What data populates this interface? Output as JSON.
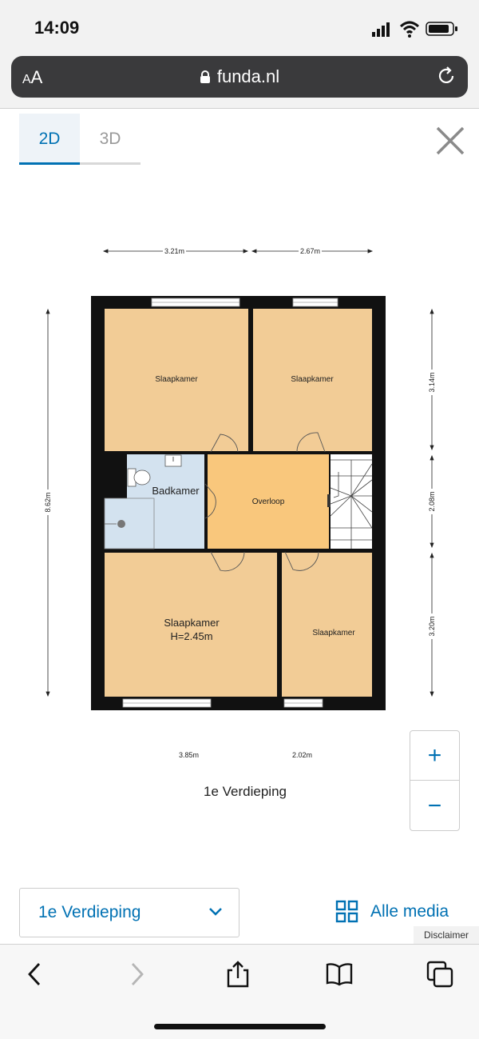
{
  "status_bar": {
    "time": "14:09"
  },
  "browser": {
    "text_size_small": "A",
    "text_size_large": "A",
    "domain": "funda.nl"
  },
  "tabs": [
    {
      "label": "2D"
    },
    {
      "label": "3D"
    }
  ],
  "floorplan": {
    "rooms": {
      "bedroom_top_left": "Slaapkamer",
      "bedroom_top_right": "Slaapkamer",
      "bathroom": "Badkamer",
      "landing": "Overloop",
      "bedroom_bottom_left": "Slaapkamer",
      "bedroom_bottom_left_height": "H=2.45m",
      "bedroom_bottom_right": "Slaapkamer"
    },
    "dimensions": {
      "top_left": "3.21m",
      "top_right": "2.67m",
      "left_total": "8.62m",
      "right_top": "3.14m",
      "right_middle": "2.08m",
      "right_bottom": "3.20m",
      "bottom_left": "3.85m",
      "bottom_right": "2.02m"
    },
    "floor_title": "1e Verdieping"
  },
  "zoom": {
    "in": "+",
    "out": "−"
  },
  "floor_select": {
    "value": "1e Verdieping"
  },
  "all_media": {
    "label": "Alle media"
  },
  "disclaimer": "Disclaimer",
  "colors": {
    "accent": "#0071b3",
    "bedroom": "#f2cc96",
    "landing": "#f9c77c",
    "bathroom": "#d3e2ef",
    "wall": "#111111"
  }
}
